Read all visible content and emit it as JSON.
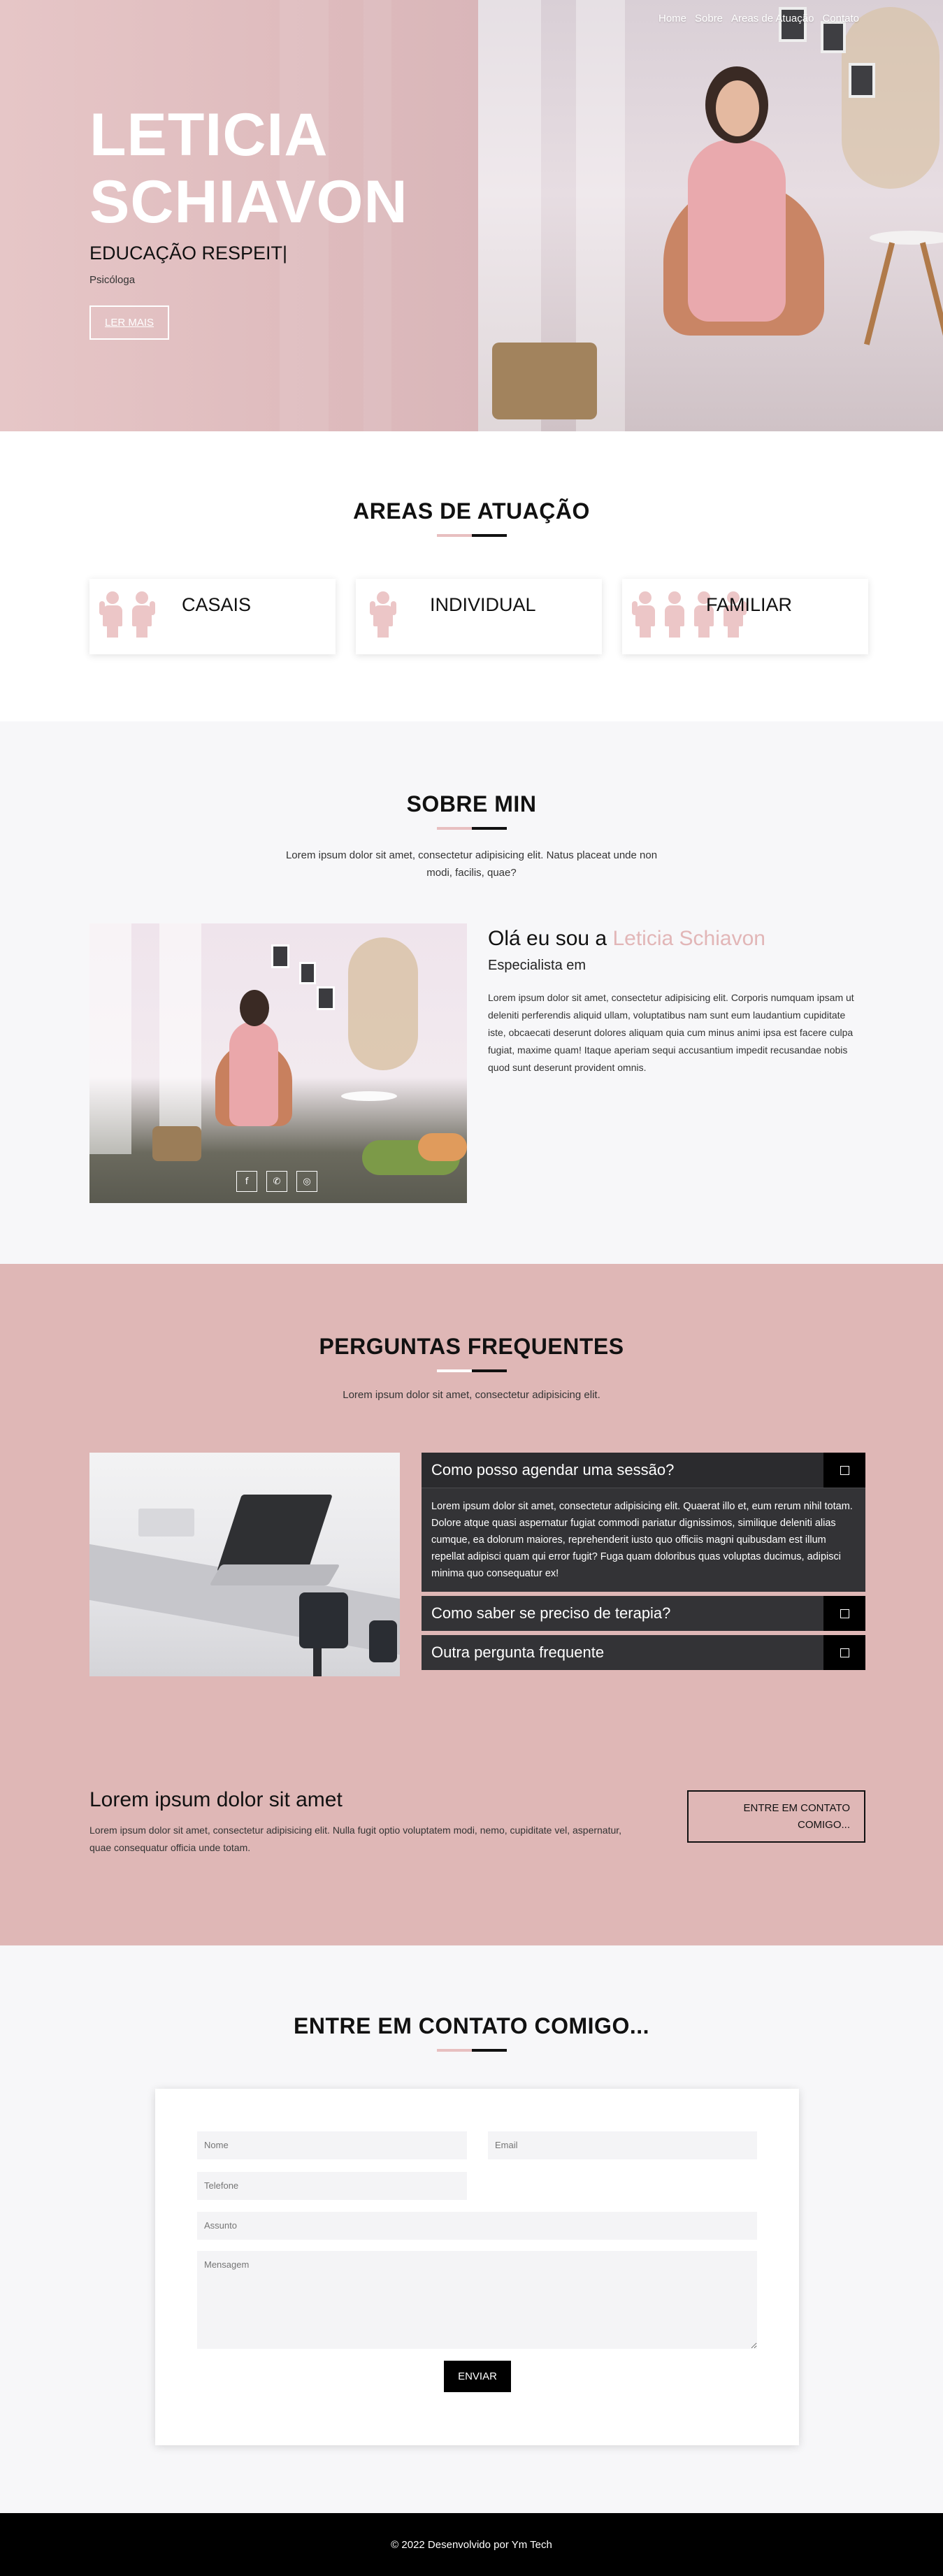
{
  "nav": {
    "items": [
      "Home",
      "Sobre",
      "Areas de Atuação",
      "Contato"
    ]
  },
  "hero": {
    "title_line1": "LETICIA",
    "title_line2": "SCHIAVON",
    "typing_text": "EDUCAÇÃO RESPEIT|",
    "role": "Psicóloga",
    "cta_label": "LER MAIS"
  },
  "areas": {
    "title": "AREAS DE ATUAÇÃO",
    "cards": [
      {
        "label": "CASAIS",
        "icon": "couple-icon"
      },
      {
        "label": "INDIVIDUAL",
        "icon": "person-icon"
      },
      {
        "label": "FAMILIAR",
        "icon": "family-icon"
      }
    ]
  },
  "sobre": {
    "title": "SOBRE MIN",
    "subtitle": "Lorem ipsum dolor sit amet, consectetur adipisicing elit. Natus placeat unde non modi, facilis, quae?",
    "greeting": "Olá eu sou a",
    "name": "Leticia Schiavon",
    "specialty": "Especialista em",
    "paragraph": "Lorem ipsum dolor sit amet, consectetur adipisicing elit. Corporis numquam ipsam ut deleniti perferendis aliquid ullam, voluptatibus nam sunt eum laudantium cupiditate iste, obcaecati deserunt dolores aliquam quia cum minus animi ipsa est facere culpa fugiat, maxime quam! Itaque aperiam sequi accusantium impedit recusandae nobis quod sunt deserunt provident omnis.",
    "socials": [
      "facebook-icon",
      "whatsapp-icon",
      "instagram-icon"
    ],
    "social_glyphs": [
      "f",
      "✆",
      "◎"
    ]
  },
  "faq": {
    "title": "PERGUNTAS FREQUENTES",
    "subtitle": "Lorem ipsum dolor sit amet, consectetur adipisicing elit.",
    "items": [
      {
        "question": "Como posso agendar uma sessão?",
        "answer": "Lorem ipsum dolor sit amet, consectetur adipisicing elit. Quaerat illo et, eum rerum nihil totam. Dolore atque quasi aspernatur fugiat commodi pariatur dignissimos, similique deleniti alias cumque, ea dolorum maiores, reprehenderit iusto quo officiis magni quibusdam est illum repellat adipisci quam qui error fugit? Fuga quam doloribus quas voluptas ducimus, adipisci minima quo consequatur ex!",
        "open": true
      },
      {
        "question": "Como saber se preciso de terapia?",
        "open": false
      },
      {
        "question": "Outra pergunta frequente",
        "open": false
      }
    ]
  },
  "cta": {
    "title": "Lorem ipsum dolor sit amet",
    "text": "Lorem ipsum dolor sit amet, consectetur adipisicing elit. Nulla fugit optio voluptatem modi, nemo, cupiditate vel, aspernatur, quae consequatur officia unde totam.",
    "button_line1": "ENTRE EM CONTATO",
    "button_line2": "COMIGO..."
  },
  "contato": {
    "title": "ENTRE EM CONTATO COMIGO...",
    "placeholders": {
      "nome": "Nome",
      "email": "Email",
      "telefone": "Telefone",
      "assunto": "Assunto",
      "mensagem": "Mensagem"
    },
    "send_label": "ENVIAR"
  },
  "footer": {
    "text": "© 2022 Desenvolvido por Ym Tech"
  },
  "colors": {
    "accent_pink": "#dfb7b6",
    "light_pink": "#e8bfc0",
    "dark": "#000000",
    "faq_dark": "#333336"
  }
}
